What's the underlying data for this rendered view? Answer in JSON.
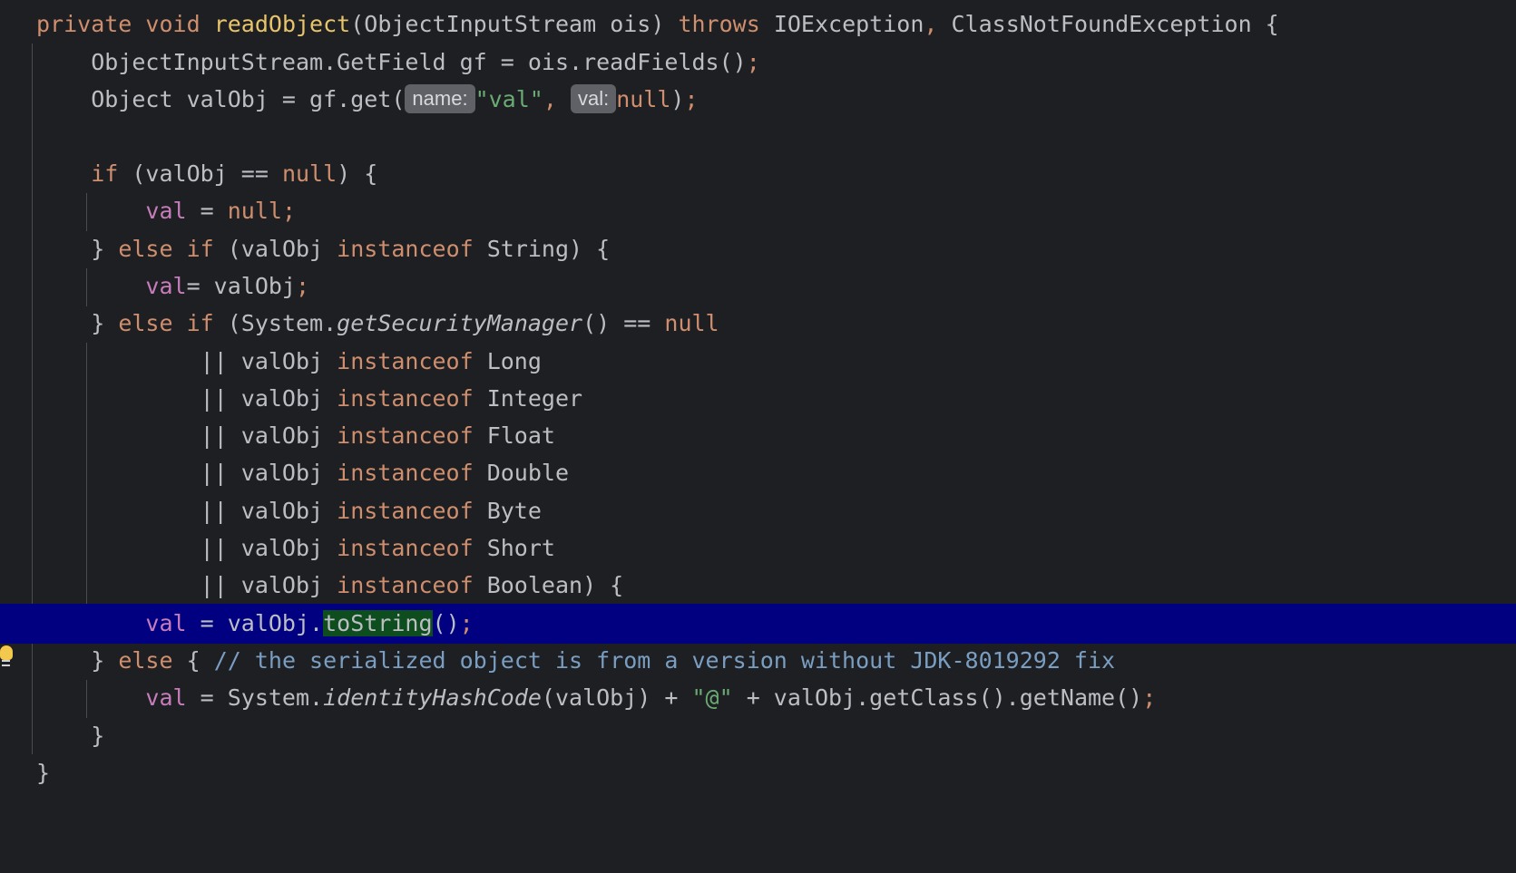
{
  "colors": {
    "background": "#1e1f22",
    "keyword": "#cf8e6d",
    "method_declaration": "#e8c46a",
    "string": "#6aab73",
    "field": "#c77dbb",
    "comment": "#7a9ec2",
    "current_line": "#000080",
    "usage_highlight": "#0d4d1e"
  },
  "icons": {
    "gutter": "lightbulb-icon"
  },
  "code": {
    "l1": {
      "private": "private",
      "void": "void",
      "method": "readObject",
      "params": "(ObjectInputStream ois) ",
      "throws": "throws",
      "ex1": " IOException",
      "comma": ",",
      "ex2": " ClassNotFoundException {"
    },
    "l2": {
      "text": "ObjectInputStream.GetField gf = ois.readFields()",
      "semi": ";"
    },
    "l3": {
      "pre": "Object valObj = gf.get(",
      "hint_name": "name:",
      "str": "\"val\"",
      "comma": ",",
      "hint_val": "val:",
      "null": "null",
      "close": ")",
      "semi": ";"
    },
    "l5": {
      "if": "if",
      "cond": " (valObj == ",
      "null": "null",
      "close": ") {"
    },
    "l6": {
      "val": "val",
      "eq": " = ",
      "null": "null",
      "semi": ";"
    },
    "l7": {
      "brace": "} ",
      "else_if": "else if",
      "pre": " (valObj ",
      "instanceof": "instanceof",
      "post": " String) {"
    },
    "l8": {
      "val": "val",
      "rest": "= valObj",
      "semi": ";"
    },
    "l9": {
      "brace": "} ",
      "else_if": "else if",
      "pre": " (System.",
      "method": "getSecurityManager",
      "mid": "() == ",
      "null": "null"
    },
    "cond_prefix": "|| valObj ",
    "instanceof": "instanceof",
    "l10": {
      "type": " Long"
    },
    "l11": {
      "type": " Integer"
    },
    "l12": {
      "type": " Float"
    },
    "l13": {
      "type": " Double"
    },
    "l14": {
      "type": " Byte"
    },
    "l15": {
      "type": " Short"
    },
    "l16": {
      "type": " Boolean) {"
    },
    "l17": {
      "val": "val",
      "pre": " = valObj.",
      "method": "toString",
      "post": "()",
      "semi": ";"
    },
    "l18": {
      "brace": "} ",
      "else": "else",
      "open": " { ",
      "comment": "// the serialized object is from a version without JDK-8019292 fix"
    },
    "l19": {
      "val": "val",
      "pre": " = System.",
      "method": "identityHashCode",
      "mid": "(valObj) + ",
      "str": "\"@\"",
      "post": " + valObj.getClass().getName()",
      "semi": ";"
    },
    "l20": {
      "text": "}"
    },
    "l21": {
      "text": "}"
    }
  }
}
